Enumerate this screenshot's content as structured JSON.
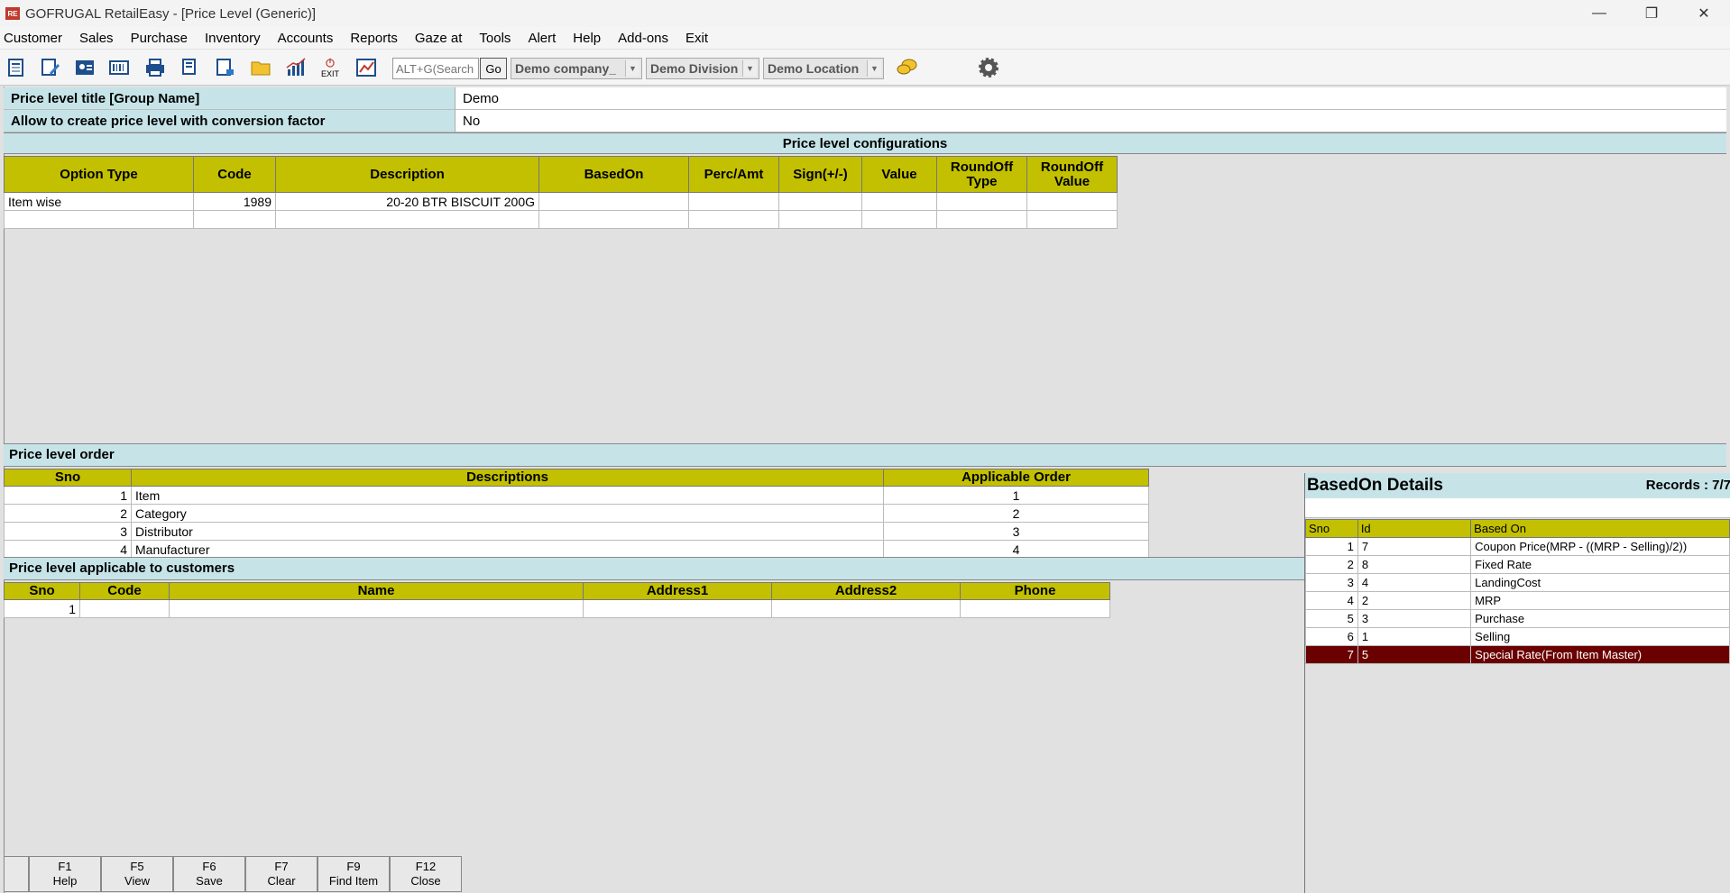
{
  "window": {
    "title": "GOFRUGAL RetailEasy - [Price Level (Generic)]",
    "logo_text": "RE"
  },
  "menu": [
    "Customer",
    "Sales",
    "Purchase",
    "Inventory",
    "Accounts",
    "Reports",
    "Gaze at",
    "Tools",
    "Alert",
    "Help",
    "Add-ons",
    "Exit"
  ],
  "toolbar": {
    "search_placeholder": "ALT+G(Search",
    "go_label": "Go",
    "company": "Demo company_",
    "division": "Demo Division",
    "location": "Demo Location",
    "exit_label": "EXIT"
  },
  "header": {
    "title_label": "Price level title [Group Name]",
    "title_value": "Demo",
    "conversion_label": "Allow to create price level with conversion factor",
    "conversion_value": "No"
  },
  "config": {
    "section_title": "Price level configurations",
    "columns": [
      "Option Type",
      "Code",
      "Description",
      "BasedOn",
      "Perc/Amt",
      "Sign(+/-)",
      "Value",
      "RoundOff Type",
      "RoundOff Value"
    ],
    "rows": [
      [
        "Item wise",
        "1989",
        "20-20 BTR BISCUIT 200G",
        "",
        "",
        "",
        "",
        "",
        ""
      ]
    ]
  },
  "order": {
    "section_title": "Price level order",
    "columns": [
      "Sno",
      "Descriptions",
      "Applicable Order"
    ],
    "rows": [
      [
        "1",
        "Item",
        "1"
      ],
      [
        "2",
        "Category",
        "2"
      ],
      [
        "3",
        "Distributor",
        "3"
      ],
      [
        "4",
        "Manufacturer",
        "4"
      ]
    ]
  },
  "customers": {
    "section_title": "Price level applicable to customers",
    "columns": [
      "Sno",
      "Code",
      "Name",
      "Address1",
      "Address2",
      "Phone"
    ],
    "rows": [
      [
        "1",
        "",
        "",
        "",
        "",
        ""
      ]
    ]
  },
  "based_on": {
    "title": "BasedOn Details",
    "records": "Records : 7/7",
    "columns": [
      "Sno",
      "Id",
      "Based On"
    ],
    "rows": [
      [
        "1",
        "7",
        "Coupon Price(MRP - ((MRP - Selling)/2))"
      ],
      [
        "2",
        "8",
        "Fixed Rate"
      ],
      [
        "3",
        "4",
        "LandingCost"
      ],
      [
        "4",
        "2",
        "MRP"
      ],
      [
        "5",
        "3",
        "Purchase"
      ],
      [
        "6",
        "1",
        "Selling"
      ],
      [
        "7",
        "5",
        "Special Rate(From Item Master)"
      ]
    ],
    "selected_row": 6
  },
  "fkeys": [
    {
      "key": "F1",
      "label": "Help"
    },
    {
      "key": "F5",
      "label": "View"
    },
    {
      "key": "F6",
      "label": "Save"
    },
    {
      "key": "F7",
      "label": "Clear"
    },
    {
      "key": "F9",
      "label": "Find Item"
    },
    {
      "key": "F12",
      "label": "Close"
    }
  ],
  "colors": {
    "section_bg": "#c6e4e8",
    "grid_header": "#c2c000",
    "selected_row": "#6b0000"
  }
}
